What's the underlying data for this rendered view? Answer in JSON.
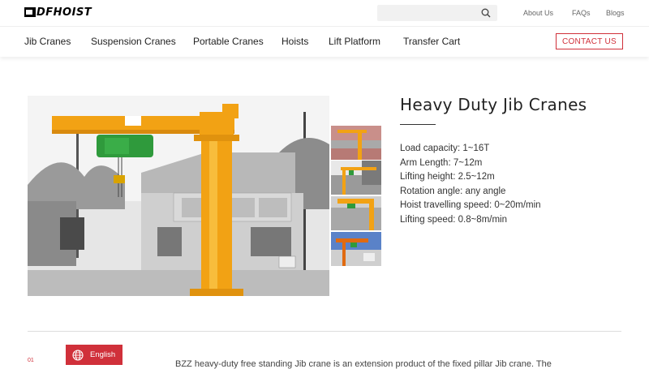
{
  "header": {
    "logo_text": "DFHOIST",
    "search": {
      "placeholder": "",
      "icon": "search-icon"
    },
    "links": [
      "About Us",
      "FAQs",
      "Blogs"
    ]
  },
  "nav": {
    "items": [
      "Jib Cranes",
      "Suspension Cranes",
      "Portable Cranes",
      "Hoists",
      "Lift Platform",
      "Transfer Cart"
    ],
    "contact_label": "CONTACT US"
  },
  "product": {
    "title": "Heavy Duty Jib Cranes",
    "specs": [
      "Load capacity: 1~16T",
      "Arm Length: 7~12m",
      "Lifting height: 2.5~12m",
      "Rotation angle: any angle",
      "Hoist travelling speed: 0~20m/min",
      "Lifting speed: 0.8~8m/min"
    ]
  },
  "section": {
    "number": "01",
    "paragraph": "BZZ heavy-duty free standing Jib crane is an extension product of the fixed pillar Jib crane. The"
  },
  "language": {
    "label": "English",
    "icon": "globe-icon"
  },
  "colors": {
    "accent": "#d0303a",
    "crane_orange": "#f2a214",
    "hoist_green": "#2f9a3c"
  }
}
